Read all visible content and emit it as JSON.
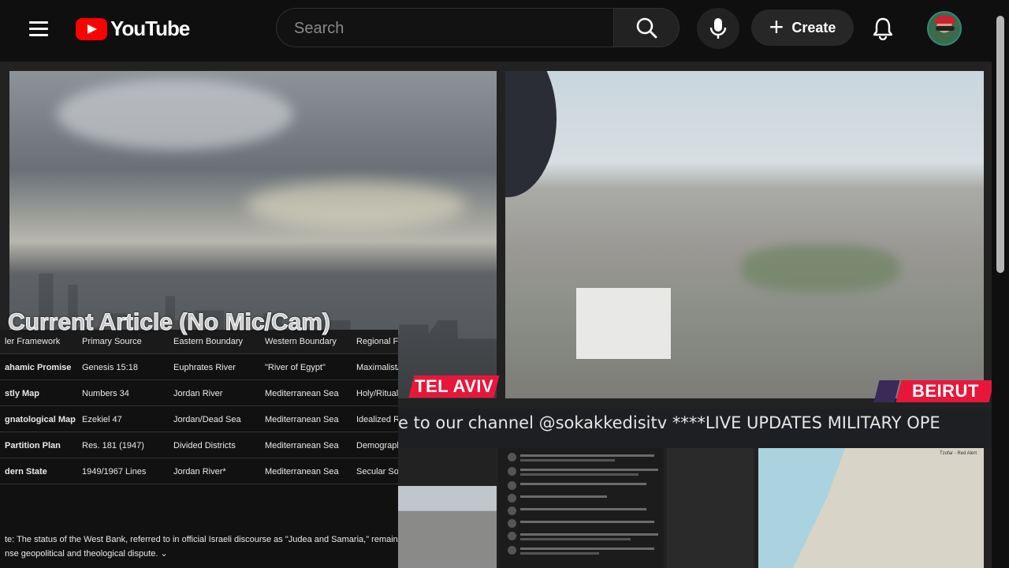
{
  "header": {
    "logo_text": "YouTube",
    "search_placeholder": "Search",
    "create_label": "Create",
    "icons": [
      "menu-icon",
      "search-icon",
      "mic-icon",
      "plus-icon",
      "bell-icon"
    ]
  },
  "video": {
    "city_tags": {
      "left": "TEL AVIV",
      "right": "BEIRUT"
    },
    "ticker_text": "e to our channel @sokakkedisitv   ****LIVE UPDATES MILITARY OPE",
    "article_title": "Current Article (No Mic/Cam)",
    "table": {
      "headers": [
        "ler Framework",
        "Primary Source",
        "Eastern Boundary",
        "Western Boundary",
        "Regional Fo"
      ],
      "rows": [
        [
          "ahamic Promise",
          "Genesis 15:18",
          "Euphrates River",
          "\"River of Egypt\"",
          "Maximalist/"
        ],
        [
          "stly Map",
          "Numbers 34",
          "Jordan River",
          "Mediterranean Sea",
          "Holy/Rituali"
        ],
        [
          "gnatological Map",
          "Ezekiel 47",
          "Jordan/Dead Sea",
          "Mediterranean Sea",
          "Idealized Re"
        ],
        [
          "Partition Plan",
          "Res. 181 (1947)",
          "Divided Districts",
          "Mediterranean Sea",
          "Demograph"
        ],
        [
          "dern State",
          "1949/1967 Lines",
          "Jordan River*",
          "Mediterranean Sea",
          "Secular Sov"
        ]
      ]
    },
    "note_line1": "te: The status of the West Bank, referred to in official Israeli discourse as \"Judea and Samaria,\" remains a point",
    "note_line2": "nse geopolitical and theological dispute.  ⌄",
    "map_title": "Tzofar - Red Alert"
  },
  "colors": {
    "brand_red": "#ff0000",
    "tag_red": "#e8173a",
    "bg": "#0f0f0f"
  }
}
